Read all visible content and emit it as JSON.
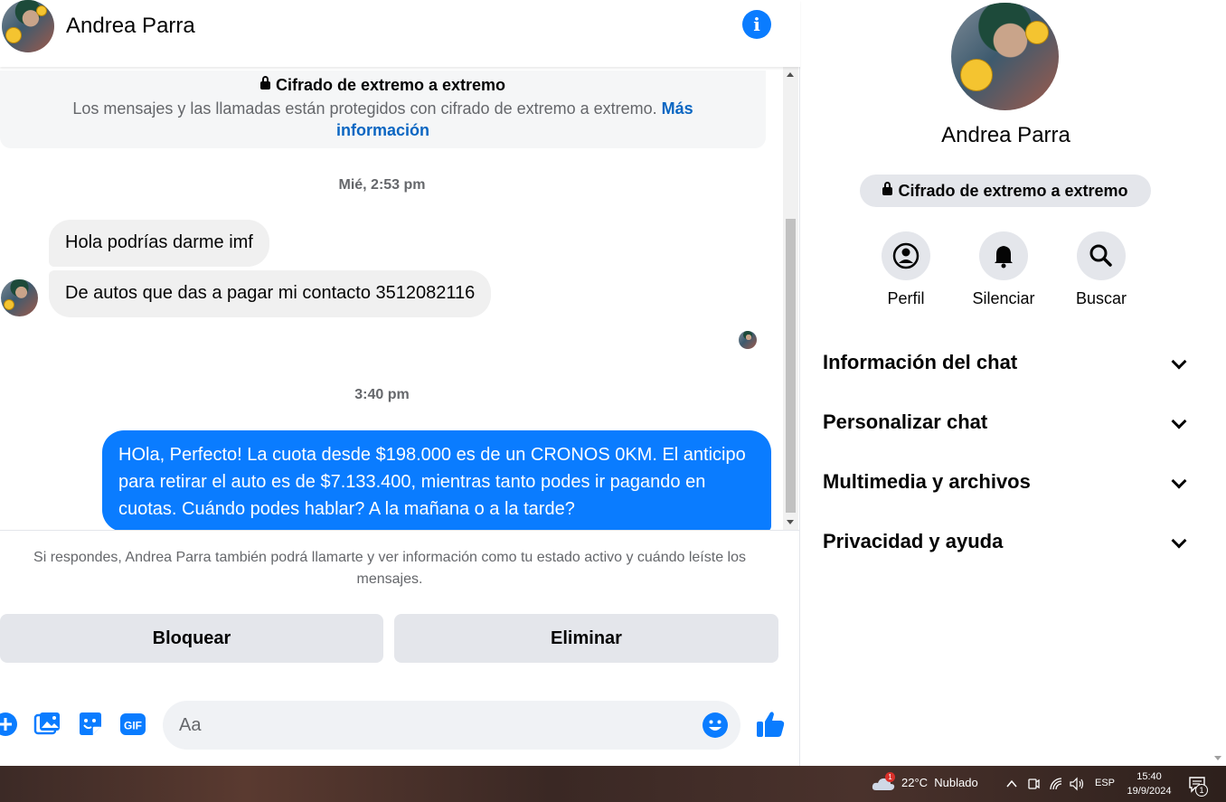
{
  "header": {
    "contact_name": "Andrea Parra",
    "info_icon": "info-icon"
  },
  "e2e_notice": {
    "title": "Cifrado de extremo a extremo",
    "text": "Los mensajes y las llamadas están protegidos con cifrado de extremo a extremo.",
    "link": "Más información"
  },
  "messages": [
    {
      "type": "timestamp",
      "text": "Mié, 2:53 pm"
    },
    {
      "type": "incoming",
      "text": "Hola podrías darme imf"
    },
    {
      "type": "incoming",
      "text": "De autos que das a pagar mi contacto 3512082116"
    },
    {
      "type": "timestamp",
      "text": "3:40 pm"
    },
    {
      "type": "outgoing",
      "text": "HOla, Perfecto! La cuota desde $198.000 es de un CRONOS 0KM. El anticipo para retirar el auto es de $7.133.400, mientras tanto podes ir pagando en cuotas. Cuándo podes hablar? A la mañana o a la tarde?"
    }
  ],
  "reply_notice": "Si respondes, Andrea Parra también podrá llamarte y ver información como tu estado activo y cuándo leíste los mensajes.",
  "actions": {
    "block": "Bloquear",
    "delete": "Eliminar"
  },
  "composer": {
    "placeholder": "Aa",
    "icons": [
      "plus-icon",
      "photo-icon",
      "sticker-icon",
      "gif-icon",
      "emoji-icon",
      "thumbs-up-icon"
    ],
    "gif_label": "GIF"
  },
  "side_panel": {
    "name": "Andrea Parra",
    "e2e_pill": "Cifrado de extremo a extremo",
    "quick_actions": [
      {
        "label": "Perfil",
        "icon": "profile-icon"
      },
      {
        "label": "Silenciar",
        "icon": "bell-icon"
      },
      {
        "label": "Buscar",
        "icon": "search-icon"
      }
    ],
    "sections": [
      "Información del chat",
      "Personalizar chat",
      "Multimedia y archivos",
      "Privacidad y ayuda"
    ]
  },
  "taskbar": {
    "weather_badge": "1",
    "weather": "22°C  Nublado",
    "language": "ESP",
    "time": "15:40",
    "date": "19/9/2024",
    "notification_count": "1"
  },
  "colors": {
    "accent": "#0a7cff",
    "bubble_in": "#f0f0f0",
    "button_bg": "#e4e6eb"
  }
}
